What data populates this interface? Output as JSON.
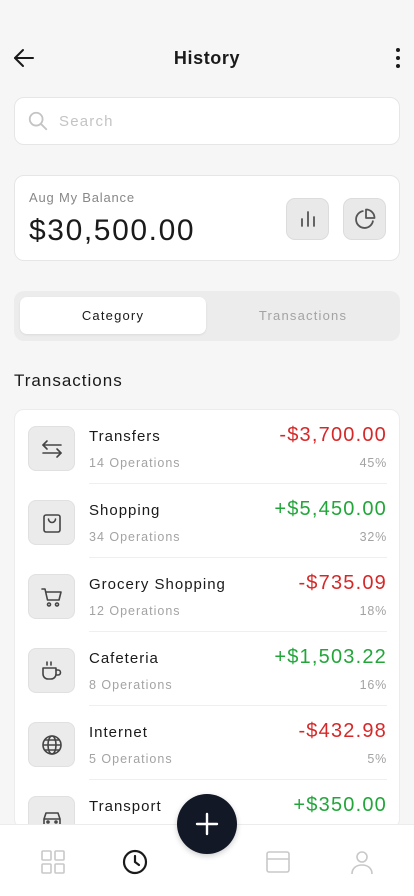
{
  "header": {
    "title": "History",
    "back_icon": "arrow-left-icon",
    "menu_icon": "more-vertical-icon"
  },
  "search": {
    "placeholder": "Search"
  },
  "balance": {
    "label": "Aug My Balance",
    "amount": "$30,500.00"
  },
  "segments": {
    "active": "Category",
    "inactive": "Transactions"
  },
  "section": {
    "title": "Transactions"
  },
  "transactions": [
    {
      "icon": "transfer-arrows-icon",
      "name": "Transfers",
      "ops": "14 Operations",
      "amount": "-$3,700.00",
      "pct": "45%",
      "sign": "neg"
    },
    {
      "icon": "shopping-bag-icon",
      "name": "Shopping",
      "ops": "34 Operations",
      "amount": "+$5,450.00",
      "pct": "32%",
      "sign": "pos"
    },
    {
      "icon": "shopping-cart-icon",
      "name": "Grocery Shopping",
      "ops": "12 Operations",
      "amount": "-$735.09",
      "pct": "18%",
      "sign": "neg"
    },
    {
      "icon": "coffee-cup-icon",
      "name": "Cafeteria",
      "ops": "8 Operations",
      "amount": "+$1,503.22",
      "pct": "16%",
      "sign": "pos"
    },
    {
      "icon": "globe-icon",
      "name": "Internet",
      "ops": "5 Operations",
      "amount": "-$432.98",
      "pct": "5%",
      "sign": "neg"
    },
    {
      "icon": "car-icon",
      "name": "Transport",
      "ops": "",
      "amount": "+$350.00",
      "pct": "",
      "sign": "pos"
    }
  ],
  "colors": {
    "negative": "#d62828",
    "positive": "#22a63a",
    "fab": "#121826"
  },
  "bottom_nav": [
    "grid-icon",
    "history-clock-icon",
    "card-icon",
    "profile-icon"
  ]
}
